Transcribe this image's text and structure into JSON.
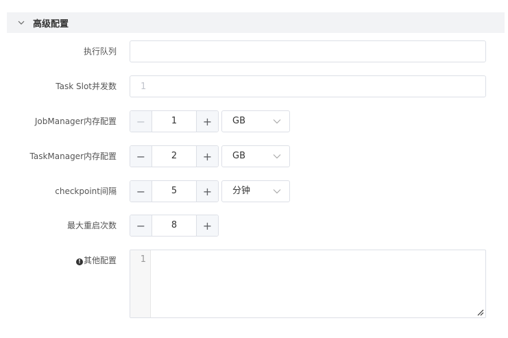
{
  "section": {
    "title": "高级配置",
    "icon": "chevron-down-icon"
  },
  "fields": {
    "queue": {
      "label": "执行队列",
      "value": "",
      "placeholder": ""
    },
    "task_slot": {
      "label": "Task Slot并发数",
      "value": "",
      "placeholder": "1"
    },
    "jobmanager_memory": {
      "label": "JobManager内存配置",
      "value": "1",
      "unit": "GB"
    },
    "taskmanager_memory": {
      "label": "TaskManager内存配置",
      "value": "2",
      "unit": "GB"
    },
    "checkpoint_interval": {
      "label": "checkpoint间隔",
      "value": "5",
      "unit": "分钟"
    },
    "max_restarts": {
      "label": "最大重启次数",
      "value": "8"
    },
    "other_config": {
      "label": "其他配置",
      "info_icon": "info-circle-icon",
      "line_number": "1"
    }
  },
  "stepper": {
    "minus": "−",
    "plus": "+"
  }
}
